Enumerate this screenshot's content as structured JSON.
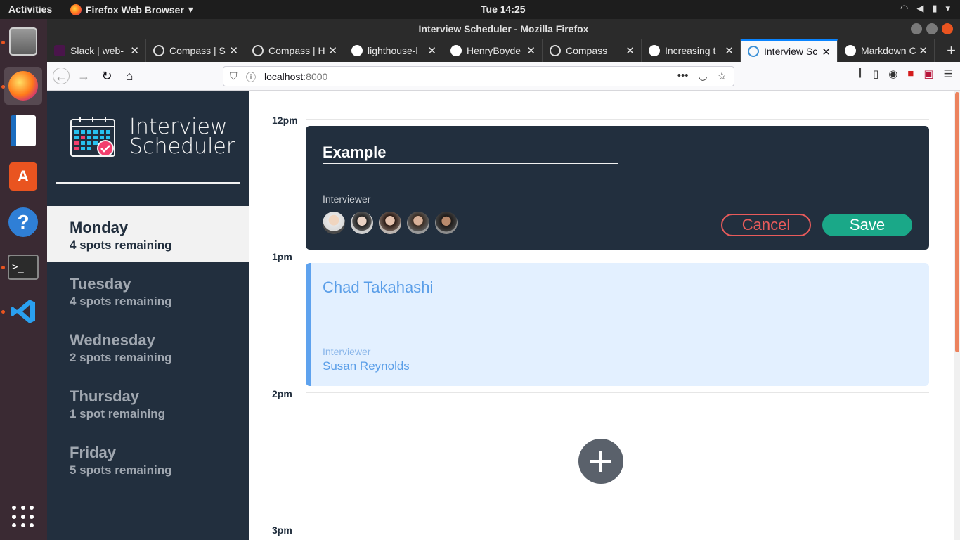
{
  "os": {
    "activities": "Activities",
    "app_name": "Firefox Web Browser",
    "clock": "Tue 14:25"
  },
  "window": {
    "title": "Interview Scheduler - Mozilla Firefox"
  },
  "tabs": [
    {
      "label": "Slack | web-",
      "color": "#4a154b"
    },
    {
      "label": "Compass | S",
      "color": "#3a3a3a"
    },
    {
      "label": "Compass | H",
      "color": "#3a3a3a"
    },
    {
      "label": "lighthouse-l",
      "color": "#ffffff"
    },
    {
      "label": "HenryBoyde",
      "color": "#ffffff"
    },
    {
      "label": "Compass",
      "color": "#3a3a3a"
    },
    {
      "label": "Increasing t",
      "color": "#ffffff"
    },
    {
      "label": "Interview Sc",
      "color": "#61dafb",
      "active": true
    },
    {
      "label": "Markdown C",
      "color": "#ffffff"
    }
  ],
  "url": {
    "host": "localhost",
    "port": ":8000"
  },
  "brand": {
    "line1": "Interview",
    "line2": "Scheduler"
  },
  "days": [
    {
      "name": "Monday",
      "spots": "4 spots remaining",
      "selected": true
    },
    {
      "name": "Tuesday",
      "spots": "4 spots remaining"
    },
    {
      "name": "Wednesday",
      "spots": "2 spots remaining"
    },
    {
      "name": "Thursday",
      "spots": "1 spot remaining"
    },
    {
      "name": "Friday",
      "spots": "5 spots remaining"
    }
  ],
  "times": [
    "12pm",
    "1pm",
    "2pm",
    "3pm"
  ],
  "form": {
    "name_value": "Example",
    "interviewer_label": "Interviewer",
    "cancel_label": "Cancel",
    "save_label": "Save"
  },
  "appointment": {
    "student": "Chad Takahashi",
    "interviewer_label": "Interviewer",
    "interviewer": "Susan Reynolds"
  },
  "colors": {
    "sidebar": "#222f3e",
    "save": "#1aa888",
    "cancel": "#e85b5b",
    "appointment_bg": "#e3f0ff",
    "appointment_accent": "#5ea2ee"
  }
}
